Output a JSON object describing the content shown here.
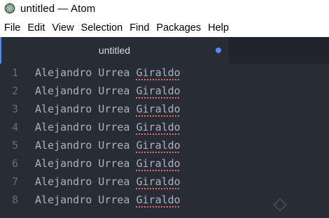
{
  "window": {
    "title": "untitled — Atom",
    "icon": "atom-icon"
  },
  "menubar": {
    "items": [
      "File",
      "Edit",
      "View",
      "Selection",
      "Find",
      "Packages",
      "Help"
    ]
  },
  "tabs": [
    {
      "label": "untitled",
      "modified": true
    }
  ],
  "editor": {
    "lines": [
      {
        "number": "1",
        "text_before": "Alejandro Urrea ",
        "misspelled": "Giraldo"
      },
      {
        "number": "2",
        "text_before": "Alejandro Urrea ",
        "misspelled": "Giraldo"
      },
      {
        "number": "3",
        "text_before": "Alejandro Urrea ",
        "misspelled": "Giraldo"
      },
      {
        "number": "4",
        "text_before": "Alejandro Urrea ",
        "misspelled": "Giraldo"
      },
      {
        "number": "5",
        "text_before": "Alejandro Urrea ",
        "misspelled": "Giraldo"
      },
      {
        "number": "6",
        "text_before": "Alejandro Urrea ",
        "misspelled": "Giraldo"
      },
      {
        "number": "7",
        "text_before": "Alejandro Urrea ",
        "misspelled": "Giraldo"
      },
      {
        "number": "8",
        "text_before": "Alejandro Urrea ",
        "misspelled": "Giraldo"
      }
    ]
  },
  "colors": {
    "editor_bg": "#282c34",
    "tabbar_bg": "#21252b",
    "accent": "#568af2",
    "text": "#abb2bf",
    "line_number": "#636d83",
    "spell_error": "#e06c75"
  }
}
